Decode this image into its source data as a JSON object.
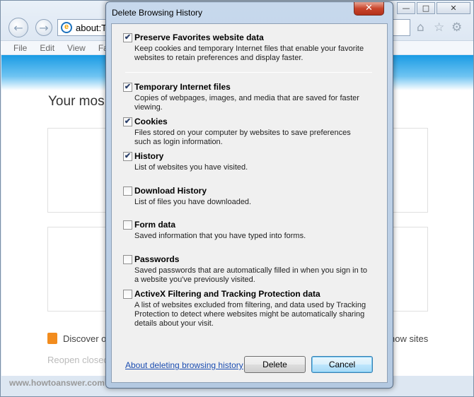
{
  "browser": {
    "address_text": "about:Ta",
    "menu": [
      "File",
      "Edit",
      "View",
      "Favo"
    ],
    "page_title": "Your mos",
    "discover_text": "Discover o",
    "show_sites_text": "how sites",
    "reopen_text": "Reopen closed",
    "watermark": "www.howtoanswer.com"
  },
  "dialog": {
    "title": "Delete Browsing History",
    "close_symbol": "✕",
    "options": [
      {
        "label": "Preserve Favorites website data",
        "checked": true,
        "desc": "Keep cookies and temporary Internet files that enable your favorite websites to retain preferences and display faster."
      },
      {
        "label": "Temporary Internet files",
        "checked": true,
        "desc": "Copies of webpages, images, and media that are saved for faster viewing."
      },
      {
        "label": "Cookies",
        "checked": true,
        "desc": "Files stored on your computer by websites to save preferences such as login information."
      },
      {
        "label": "History",
        "checked": true,
        "desc": "List of websites you have visited."
      },
      {
        "label": "Download History",
        "checked": false,
        "desc": "List of files you have downloaded."
      },
      {
        "label": "Form data",
        "checked": false,
        "desc": "Saved information that you have typed into forms."
      },
      {
        "label": "Passwords",
        "checked": false,
        "desc": "Saved passwords that are automatically filled in when you sign in to a website you've previously visited."
      },
      {
        "label": "ActiveX Filtering and Tracking Protection data",
        "checked": false,
        "desc": "A list of websites excluded from filtering, and data used by Tracking Protection to detect where websites might be automatically sharing details about your visit."
      }
    ],
    "about_link": "About deleting browsing history",
    "delete_label": "Delete",
    "cancel_label": "Cancel"
  }
}
